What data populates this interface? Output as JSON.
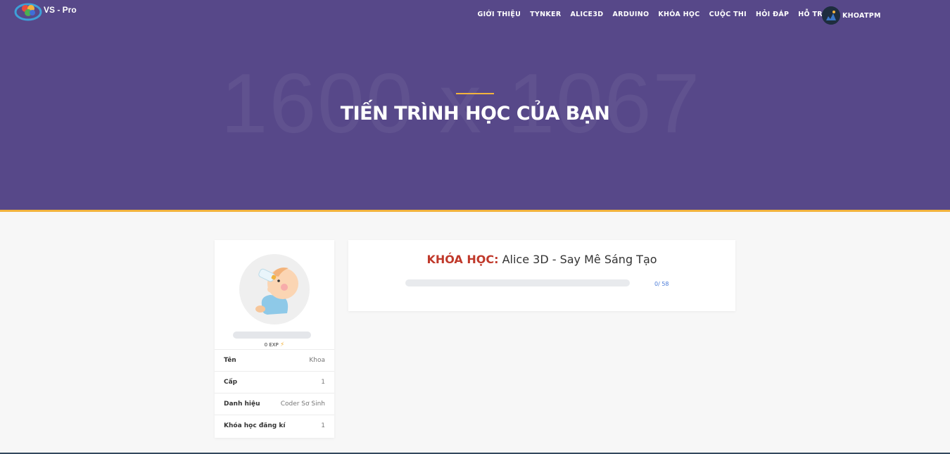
{
  "brand": {
    "name": "VS - Pro"
  },
  "nav": {
    "items": [
      "GIỚI THIỆU",
      "TYNKER",
      "ALICE3D",
      "ARDUINO",
      "KHÓA HỌC",
      "CUỘC THI",
      "HỎI ĐÁP",
      "HỖ TRỢ"
    ],
    "user": "KHOATPM"
  },
  "hero": {
    "placeholder": "1600 x 1067",
    "title": "TIẾN TRÌNH HỌC CỦA BẠN"
  },
  "profile": {
    "exp": "0 EXP",
    "rows": [
      {
        "label": "Tên",
        "value": "Khoa"
      },
      {
        "label": "Cấp",
        "value": "1"
      },
      {
        "label": "Danh hiệu",
        "value": "Coder Sơ Sinh"
      },
      {
        "label": "Khóa học đăng kí",
        "value": "1"
      }
    ]
  },
  "course": {
    "label": "KHÓA HỌC:",
    "name": "Alice 3D - Say Mê Sáng Tạo",
    "progress_text": "0/ 58",
    "progress_done": 0,
    "progress_total": 58
  },
  "colors": {
    "hero_bg": "#574889",
    "accent": "#f2b33d",
    "course_label": "#c0392b",
    "progress_text": "#4a7bd8"
  },
  "icons": [
    "logo-icon",
    "user-avatar-icon",
    "baby-avatar-icon",
    "lightning-icon"
  ]
}
